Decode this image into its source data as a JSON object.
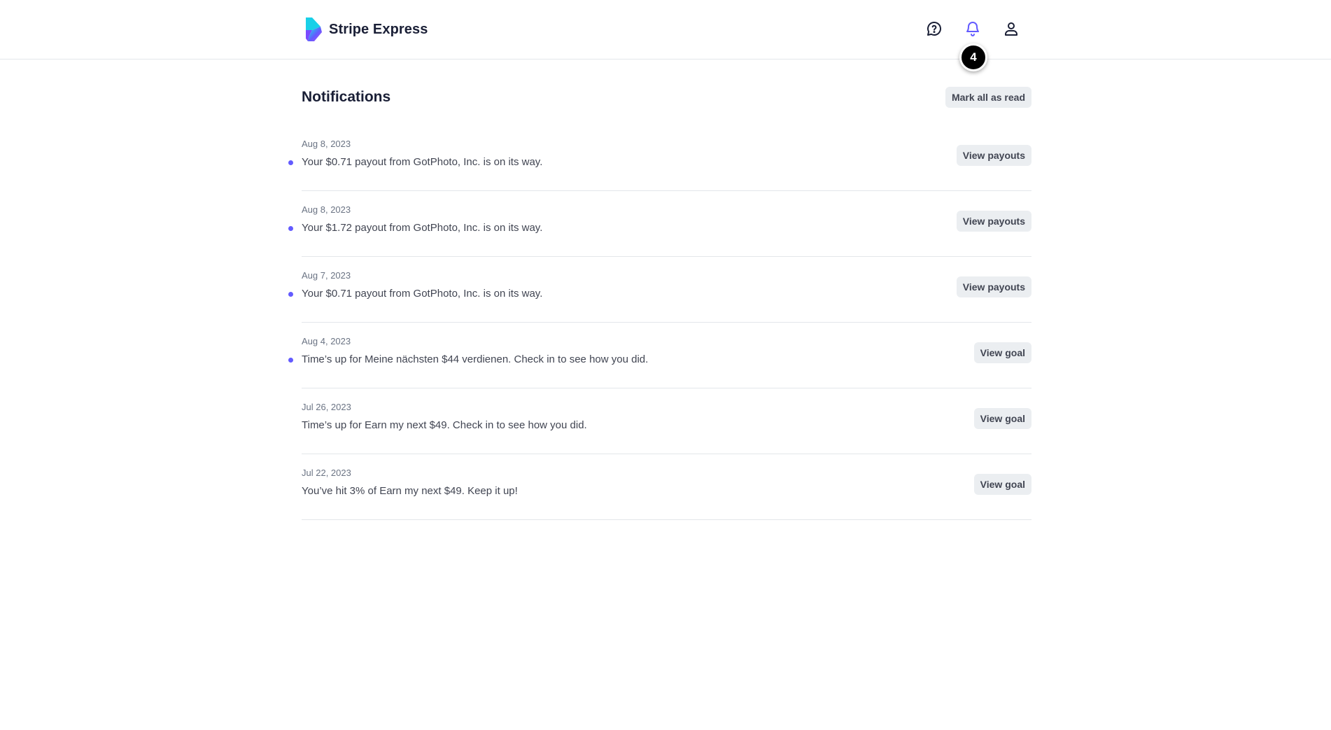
{
  "header": {
    "brand_name": "Stripe Express",
    "icons": {
      "help": "help-circle-icon",
      "bell": "bell-icon",
      "profile": "user-icon"
    },
    "notification_count": "4",
    "colors": {
      "bell_active": "#635bff",
      "badge": "#000000"
    }
  },
  "page": {
    "title": "Notifications",
    "mark_all_label": "Mark all as read"
  },
  "notifications": [
    {
      "date": "Aug 8, 2023",
      "message": "Your $0.71 payout from GotPhoto, Inc. is on its way.",
      "action": "View payouts",
      "unread": true
    },
    {
      "date": "Aug 8, 2023",
      "message": "Your $1.72 payout from GotPhoto, Inc. is on its way.",
      "action": "View payouts",
      "unread": true
    },
    {
      "date": "Aug 7, 2023",
      "message": "Your $0.71 payout from GotPhoto, Inc. is on its way.",
      "action": "View payouts",
      "unread": true
    },
    {
      "date": "Aug 4, 2023",
      "message": "Time’s up for Meine nächsten $44 verdienen. Check in to see how you did.",
      "action": "View goal",
      "unread": true
    },
    {
      "date": "Jul 26, 2023",
      "message": "Time’s up for Earn my next $49. Check in to see how you did.",
      "action": "View goal",
      "unread": false
    },
    {
      "date": "Jul 22, 2023",
      "message": "You’ve hit 3% of Earn my next $49. Keep it up!",
      "action": "View goal",
      "unread": false
    }
  ],
  "unread_dot_color": "#635bff"
}
